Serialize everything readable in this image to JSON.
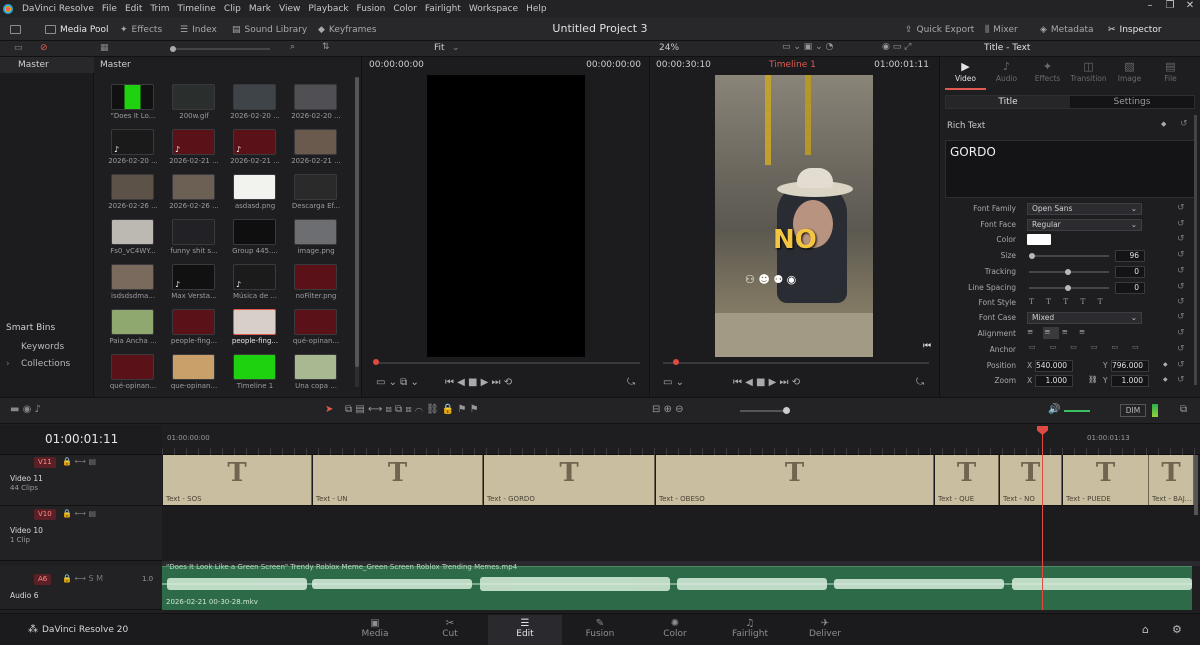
{
  "menubar": {
    "items": [
      "DaVinci Resolve",
      "File",
      "Edit",
      "Trim",
      "Timeline",
      "Clip",
      "Mark",
      "View",
      "Playback",
      "Fusion",
      "Color",
      "Fairlight",
      "Workspace",
      "Help"
    ]
  },
  "toolbar": {
    "media_pool": "Media Pool",
    "effects": "Effects",
    "index": "Index",
    "sound_library": "Sound Library",
    "keyframes": "Keyframes",
    "project_title": "Untitled Project 3",
    "quick_export": "Quick Export",
    "mixer": "Mixer",
    "metadata": "Metadata",
    "inspector": "Inspector"
  },
  "subbar": {
    "fit": "Fit",
    "zoom": "24%",
    "inspector_title": "Title - Text"
  },
  "bins": {
    "master": "Master",
    "smart_bins": "Smart Bins",
    "keywords": "Keywords",
    "collections": "Collections"
  },
  "media_pool": {
    "header": "Master",
    "clips": [
      "\"Does It Lo...",
      "200w.gif",
      "2026-02-20 ...",
      "2026-02-20 ...",
      "2026-02-20 ...",
      "2026-02-21 ...",
      "2026-02-21 ...",
      "2026-02-21 ...",
      "2026-02-26 ...",
      "2026-02-26 ...",
      "asdasd.png",
      "Descarga Ef...",
      "Fs0_vC4WY...",
      "funny shit s...",
      "Group 445....",
      "image.png",
      "isdsdsdma...",
      "Max Versta...",
      "Música de ...",
      "noFilter.png",
      "Paia Ancha ...",
      "people-fing...",
      "people-fing...",
      "qué-opinan...",
      "qué-opinan...",
      "que-opinan...",
      "Timeline 1",
      "Una copa ..."
    ]
  },
  "source_viewer": {
    "tc_left": "00:00:00:00",
    "tc_right": "00:00:00:00"
  },
  "timeline_viewer": {
    "tc_left": "00:00:30:10",
    "timeline_name": "Timeline 1",
    "tc_right": "01:00:01:11",
    "overlay_text": "NO"
  },
  "inspector": {
    "tabs": [
      "Video",
      "Audio",
      "Effects",
      "Transition",
      "Image",
      "File"
    ],
    "subtabs": [
      "Title",
      "Settings"
    ],
    "section": "Rich Text",
    "text_value": "GORDO",
    "font_family_label": "Font Family",
    "font_family": "Open Sans",
    "font_face_label": "Font Face",
    "font_face": "Regular",
    "color_label": "Color",
    "size_label": "Size",
    "size": "96",
    "tracking_label": "Tracking",
    "tracking": "0",
    "line_spacing_label": "Line Spacing",
    "line_spacing": "0",
    "font_style_label": "Font Style",
    "font_case_label": "Font Case",
    "font_case": "Mixed",
    "alignment_label": "Alignment",
    "anchor_label": "Anchor",
    "position_label": "Position",
    "pos_x_label": "X",
    "pos_x": "540.000",
    "pos_y_label": "Y",
    "pos_y": "796.000",
    "zoom_label": "Zoom",
    "zoom_x_label": "X",
    "zoom_x": "1.000",
    "zoom_y_label": "Y",
    "zoom_y": "1.000"
  },
  "timeline": {
    "timecode": "01:00:01:11",
    "ruler_start": "01:00:00:00",
    "ruler_end": "01:00:01:13",
    "dim": "DIM",
    "tracks": [
      {
        "badge": "V11",
        "name": "Video 11",
        "clips": "44 Clips"
      },
      {
        "badge": "V10",
        "name": "Video 10",
        "clips": "1 Clip"
      },
      {
        "badge": "A6",
        "name": "Audio 6",
        "level": "1.0"
      }
    ],
    "text_clips": [
      "Text - SOS",
      "Text - UN",
      "Text - GORDO",
      "Text - OBESO",
      "Text - QUE",
      "Text - NO",
      "Text - PUEDE",
      "Text - BAJ..."
    ],
    "audio_clip_name": "2026-02-21 00-30-28.mkv",
    "audio_clip_title": "\"Does It Look Like a Green Screen\" Trendy Roblox Meme_Green Screen Roblox Trending Memes.mp4"
  },
  "pages": {
    "app_name": "DaVinci Resolve 20",
    "tabs": [
      "Media",
      "Cut",
      "Edit",
      "Fusion",
      "Color",
      "Fairlight",
      "Deliver"
    ]
  }
}
